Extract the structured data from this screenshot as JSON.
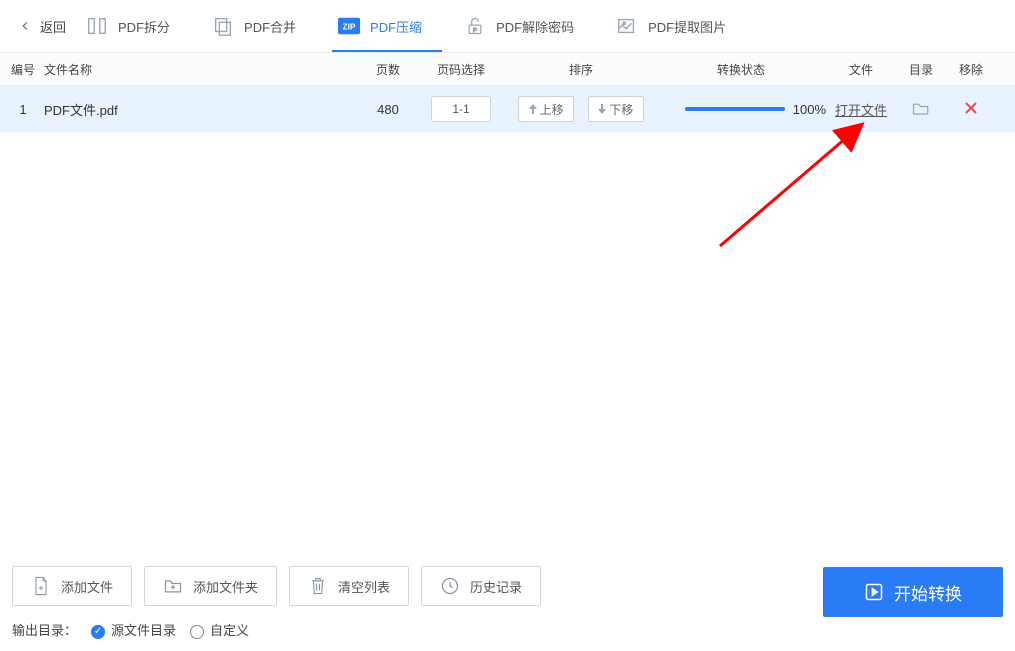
{
  "topbar": {
    "back": "返回",
    "tabs": [
      {
        "label": "PDF拆分"
      },
      {
        "label": "PDF合并"
      },
      {
        "label": "PDF压缩"
      },
      {
        "label": "PDF解除密码"
      },
      {
        "label": "PDF提取图片"
      }
    ]
  },
  "columns": {
    "idx": "编号",
    "name": "文件名称",
    "pages": "页数",
    "range": "页码选择",
    "sort": "排序",
    "status": "转换状态",
    "file": "文件",
    "dir": "目录",
    "del": "移除"
  },
  "rows": [
    {
      "idx": "1",
      "name": "PDF文件.pdf",
      "pages": "480",
      "range": "1-1",
      "move_up": "上移",
      "move_down": "下移",
      "progress_pct": "100%",
      "open_label": "打开文件"
    }
  ],
  "bottom": {
    "add_file": "添加文件",
    "add_folder": "添加文件夹",
    "clear": "清空列表",
    "history": "历史记录",
    "start": "开始转换",
    "outdir_label": "输出目录：",
    "opt_source": "源文件目录",
    "opt_custom": "自定义"
  }
}
